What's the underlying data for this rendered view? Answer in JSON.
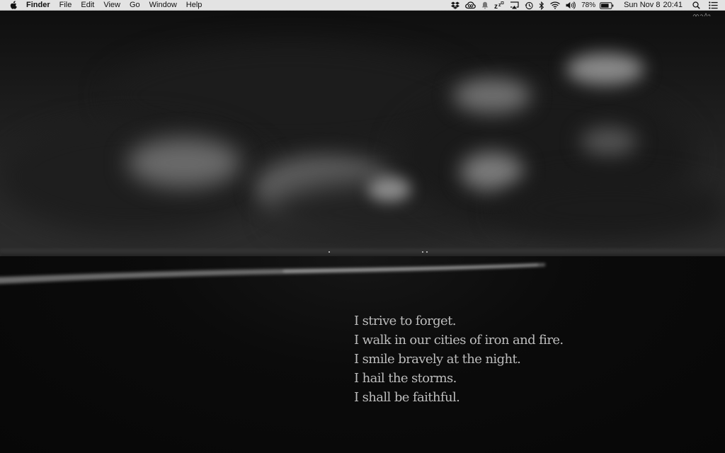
{
  "menubar": {
    "apple_icon": "apple-icon",
    "app_name": "Finder",
    "menus": [
      "File",
      "Edit",
      "View",
      "Go",
      "Window",
      "Help"
    ],
    "status": {
      "battery_percent": "78%",
      "date": "Sun Nov 8",
      "time": "20:41",
      "battery_level": 0.78
    }
  },
  "desktop": {
    "poem": [
      "I strive to forget.",
      "I walk in our cities of iron and fire.",
      "I smile bravely at the night.",
      "I hail the storms.",
      "I shall be faithful."
    ]
  }
}
